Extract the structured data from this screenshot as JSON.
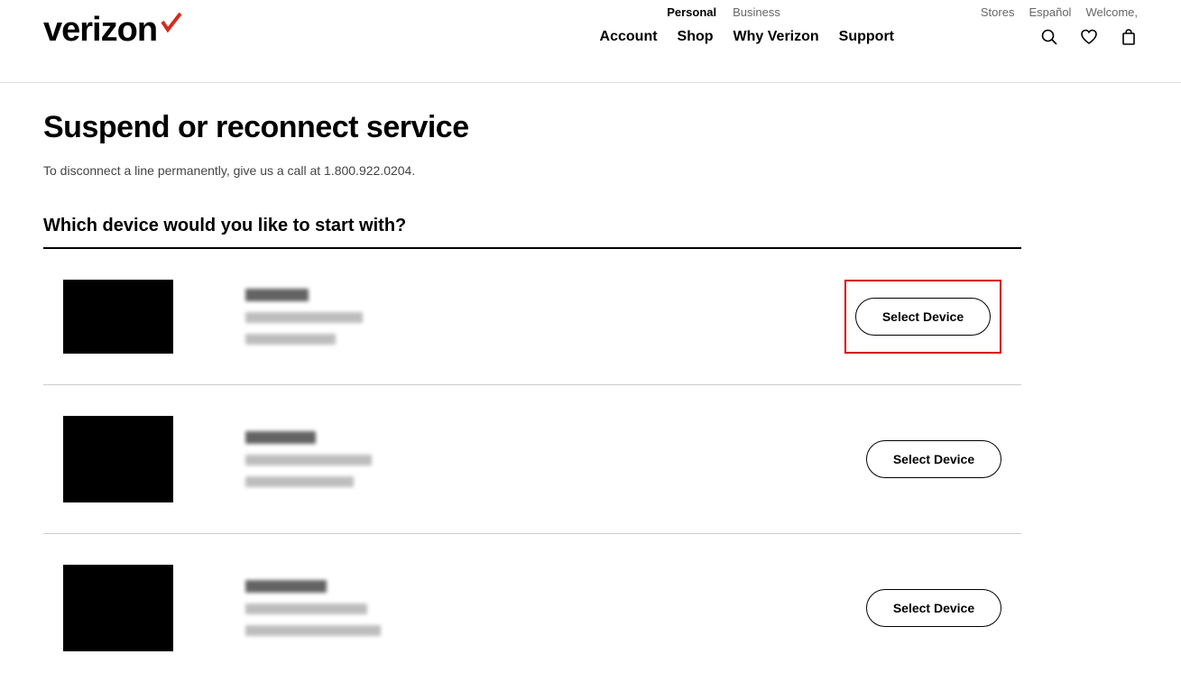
{
  "header": {
    "logo_text": "verizon",
    "segments": {
      "personal": "Personal",
      "business": "Business"
    },
    "util": {
      "stores": "Stores",
      "espanol": "Español",
      "welcome": "Welcome,"
    },
    "nav": {
      "account": "Account",
      "shop": "Shop",
      "why": "Why Verizon",
      "support": "Support"
    }
  },
  "page": {
    "title": "Suspend or reconnect service",
    "subtitle": "To disconnect a line permanently, give us a call at 1.800.922.0204.",
    "section_title": "Which device would you like to start with?"
  },
  "buttons": {
    "select_device": "Select Device"
  },
  "devices": [
    {
      "highlight": true
    },
    {
      "highlight": false
    },
    {
      "highlight": false
    }
  ]
}
